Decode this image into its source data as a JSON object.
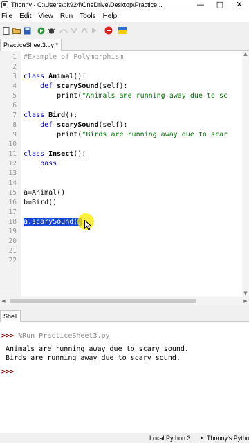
{
  "window": {
    "title": "Thonny - C:\\Users\\pk924\\OneDrive\\Desktop\\Practice..."
  },
  "menu": [
    "File",
    "Edit",
    "View",
    "Run",
    "Tools",
    "Help"
  ],
  "toolbar": {
    "icons": [
      "new-file-icon",
      "open-file-icon",
      "save-icon",
      "run-icon",
      "debug-icon",
      "step-over-icon",
      "step-into-icon",
      "step-out-icon",
      "resume-icon",
      "stop-icon",
      "flag-icon"
    ]
  },
  "editor": {
    "tab_label": "PracticeSheet3.py *",
    "line_numbers": [
      "1",
      "2",
      "3",
      "4",
      "5",
      "6",
      "7",
      "8",
      "9",
      "10",
      "11",
      "12",
      "13",
      "14",
      "15",
      "16",
      "17",
      "18",
      "19",
      "20",
      "21",
      "22"
    ],
    "lines": {
      "l1": "#Example of Polymorphism",
      "l3_kw": "class ",
      "l3_name": "Animal",
      "l3_rest": "():",
      "l4_indent": "    ",
      "l4_kw": "def ",
      "l4_name": "scarySound",
      "l4_rest": "(self):",
      "l5_pre": "        print(",
      "l5_str": "\"Animals are running away due to sc",
      "l7_kw": "class ",
      "l7_name": "Bird",
      "l7_rest": "():",
      "l8_indent": "    ",
      "l8_kw": "def ",
      "l8_name": "scarySound",
      "l8_rest": "(self):",
      "l9_pre": "        print(",
      "l9_str": "\"Birds are running away due to scar",
      "l11_kw": "class ",
      "l11_name": "Insect",
      "l11_rest": "():",
      "l12_indent": "    ",
      "l12_kw": "pass",
      "l15": "a=Animal()",
      "l16": "b=Bird()",
      "l18_sel": "a.scarySound()"
    }
  },
  "shell": {
    "tab_label": "Shell",
    "prompt": ">>>",
    "run_command": " %Run PracticeSheet3.py",
    "output": [
      " Animals are running away due to scary sound.",
      " Birds are running away due to scary sound."
    ]
  },
  "status": {
    "interpreter": "Local Python 3",
    "separator": "•",
    "backend": "Thonny's Python"
  }
}
